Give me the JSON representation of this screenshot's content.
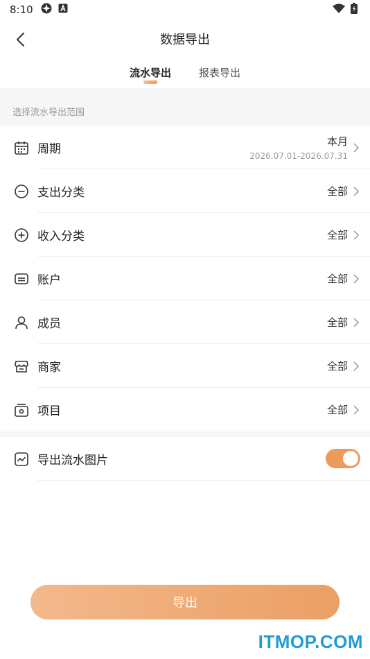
{
  "status_bar": {
    "time": "8:10"
  },
  "nav": {
    "title": "数据导出"
  },
  "tabs": [
    {
      "label": "流水导出",
      "active": true
    },
    {
      "label": "报表导出",
      "active": false
    }
  ],
  "section": {
    "label": "选择流水导出范围"
  },
  "rows": [
    {
      "label": "周期",
      "value": "本月",
      "sub": "2026.07.01-2026.07.31",
      "icon": "calendar-icon"
    },
    {
      "label": "支出分类",
      "value": "全部",
      "icon": "minus-circle-icon"
    },
    {
      "label": "收入分类",
      "value": "全部",
      "icon": "plus-circle-icon"
    },
    {
      "label": "账户",
      "value": "全部",
      "icon": "card-icon"
    },
    {
      "label": "成员",
      "value": "全部",
      "icon": "person-icon"
    },
    {
      "label": "商家",
      "value": "全部",
      "icon": "store-icon"
    },
    {
      "label": "项目",
      "value": "全部",
      "icon": "project-icon"
    }
  ],
  "toggle_row": {
    "label": "导出流水图片",
    "enabled": true,
    "icon": "chart-image-icon"
  },
  "export_button": {
    "label": "导出"
  },
  "watermark": {
    "text": "ITMOP.COM"
  },
  "colors": {
    "accent": "#ee9a5c",
    "accent_light": "#f3b88c",
    "watermark": "#1f9bd8"
  }
}
